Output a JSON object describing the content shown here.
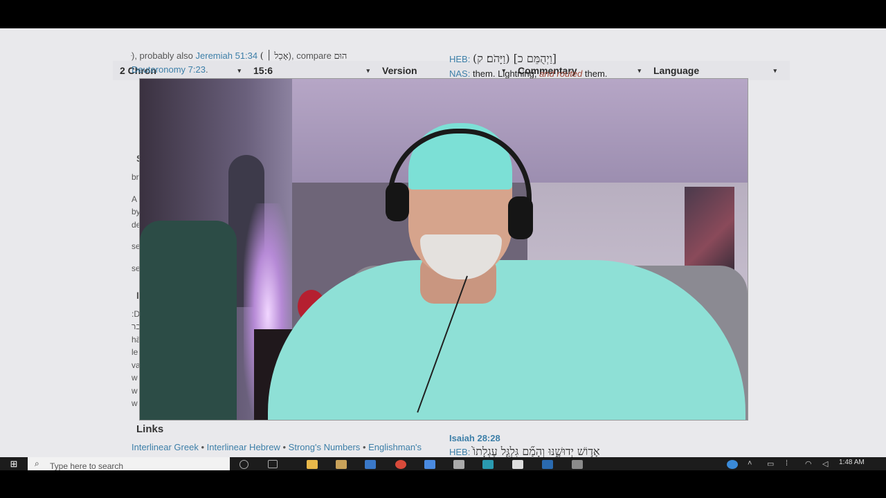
{
  "selectors": {
    "book": "2 Chron",
    "verse": "15:6",
    "version": "Version",
    "commentary": "Commentary",
    "language": "Language",
    "arrow": "▾"
  },
  "left_column": {
    "line1_prefix": "ּ), probably also",
    "line1_link": "Jeremiah 51:34",
    "line1_heb": "( אָכַל ׀",
    "line1_suffix": "), compare",
    "line1_tail": "הוּם",
    "line2_link": "Deuteronomy 7:23",
    "line2_suffix": ".",
    "partial_lines": [
      "S",
      "br",
      "A",
      "by",
      "de",
      "se",
      "se",
      "I",
      ":D",
      "בר",
      "hä",
      "le",
      "va",
      "w",
      "w",
      "w"
    ]
  },
  "right_column": {
    "heb_label": "HEB:",
    "heb_text": "(וַיָּהֹם׃ ק) [וַיְהֻמֵּם כ]",
    "nas_label": "NAS:",
    "nas_text_1": "them. Lightning,",
    "nas_text_italic": "and routed",
    "nas_text_2": "them."
  },
  "links_section": {
    "heading": "Links",
    "items": [
      "Interlinear Greek",
      "Interlinear Hebrew",
      "Strong's Numbers",
      "Englishman's"
    ],
    "separator": "•"
  },
  "isaiah": {
    "ref": "Isaiah 28:28",
    "heb_label": "HEB:",
    "heb_text": "אָד֣וֹשׁ יְדוּשֶׁ֑נּוּ וְהָמַ֞ם גִּלְגַּ֤ל עֶגְלָתוֹ֙"
  },
  "taskbar": {
    "search_placeholder": "Type here to search",
    "clock": "1:48 AM",
    "start_glyph": "⊞",
    "search_glyph": "⌕",
    "icons": [
      "cortana-icon",
      "task-view-icon",
      "file-explorer-icon",
      "store-icon",
      "edge-icon",
      "chrome-icon",
      "apps-icon",
      "bird-icon",
      "network-icon",
      "amazon-icon",
      "app-icon",
      "photos-icon"
    ]
  },
  "colors": {
    "link": "#3d7fa8",
    "taskbar": "#1c1c1c",
    "page": "#e9e9ec"
  }
}
